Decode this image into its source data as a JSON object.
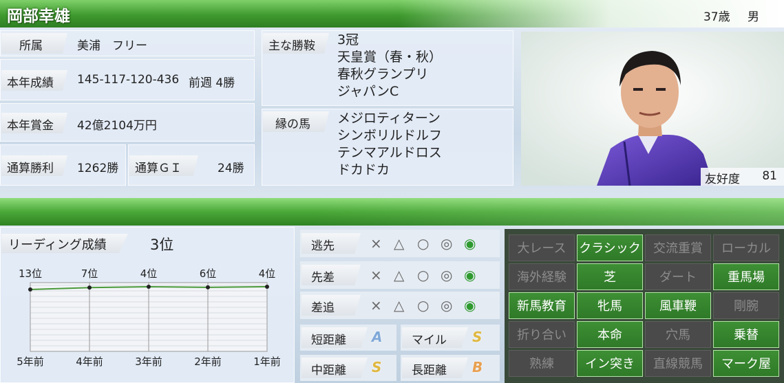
{
  "header": {
    "name": "岡部幸雄",
    "age": "37歳",
    "sex": "男"
  },
  "profile": {
    "affiliation_label": "所属",
    "affiliation_value": "美浦　フリー",
    "record_label": "本年成績",
    "record_value": "145-117-120-436",
    "lastweek_value": "前週 4勝",
    "prize_label": "本年賞金",
    "prize_value": "42億2104万円",
    "total_wins_label": "通算勝利",
    "total_wins_value": "1262勝",
    "total_g1_label": "通算ＧＩ",
    "total_g1_value": "24勝"
  },
  "main_wins": {
    "label": "主な勝鞍",
    "items": [
      "3冠",
      "天皇賞（春・秋）",
      "春秋グランプリ",
      "ジャパンC"
    ]
  },
  "bond_horses": {
    "label": "縁の馬",
    "items": [
      "メジロティターン",
      "シンボリルドルフ",
      "テンマアルドロス",
      "ドカドカ"
    ]
  },
  "favor": {
    "label": "友好度",
    "value": "81"
  },
  "leading": {
    "label": "リーディング成績",
    "value": "3位"
  },
  "chart_data": {
    "type": "line",
    "categories": [
      "5年前",
      "4年前",
      "3年前",
      "2年前",
      "1年前"
    ],
    "values": [
      13,
      7,
      4,
      6,
      4
    ],
    "point_labels": [
      "13位",
      "7位",
      "4位",
      "6位",
      "4位"
    ],
    "line_color": "#4a9a3a"
  },
  "style_marks": {
    "symbols": [
      "×",
      "△",
      "○",
      "◎",
      "◉"
    ],
    "rows": [
      {
        "label": "逃先",
        "selected": "◉"
      },
      {
        "label": "先差",
        "selected": "◉"
      },
      {
        "label": "差追",
        "selected": "◉"
      }
    ]
  },
  "distance": [
    {
      "label": "短距離",
      "grade": "A",
      "color": "#7fa8d8"
    },
    {
      "label": "マイル",
      "grade": "S",
      "color": "#e0b840"
    },
    {
      "label": "中距離",
      "grade": "S",
      "color": "#e0b840"
    },
    {
      "label": "長距離",
      "grade": "B",
      "color": "#e8a050"
    }
  ],
  "skills": [
    {
      "label": "大レース",
      "on": false
    },
    {
      "label": "クラシック",
      "on": true
    },
    {
      "label": "交流重賞",
      "on": false
    },
    {
      "label": "ローカル",
      "on": false
    },
    {
      "label": "海外経験",
      "on": false
    },
    {
      "label": "芝",
      "on": true
    },
    {
      "label": "ダート",
      "on": false
    },
    {
      "label": "重馬場",
      "on": true
    },
    {
      "label": "新馬教育",
      "on": true
    },
    {
      "label": "牝馬",
      "on": true
    },
    {
      "label": "風車鞭",
      "on": true
    },
    {
      "label": "剛腕",
      "on": false
    },
    {
      "label": "折り合い",
      "on": false
    },
    {
      "label": "本命",
      "on": true
    },
    {
      "label": "穴馬",
      "on": false
    },
    {
      "label": "乗替",
      "on": true
    },
    {
      "label": "熟練",
      "on": false
    },
    {
      "label": "イン突き",
      "on": true
    },
    {
      "label": "直線競馬",
      "on": false
    },
    {
      "label": "マーク屋",
      "on": true
    }
  ]
}
